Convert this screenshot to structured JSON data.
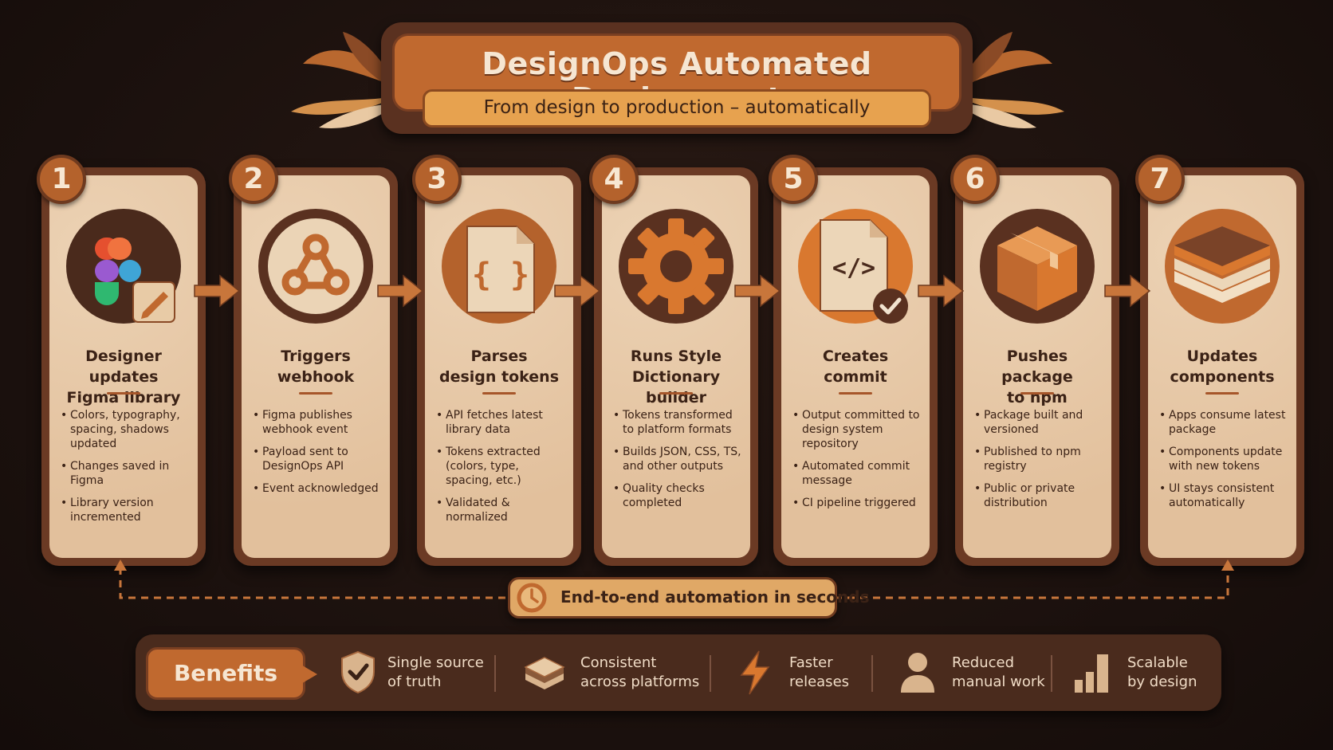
{
  "header": {
    "title": "DesignOps Automated Deployment",
    "subtitle": "From design to production – automatically"
  },
  "steps": [
    {
      "number": "1",
      "title_lines": [
        "Designer updates",
        "Figma library"
      ],
      "icon": "figma-logo-with-pencil",
      "bullets": [
        "Colors, typography, spacing, shadows updated",
        "Changes saved in Figma",
        "Library version incremented"
      ]
    },
    {
      "number": "2",
      "title_lines": [
        "Triggers",
        "webhook"
      ],
      "icon": "webhook-icon",
      "bullets": [
        "Figma publishes webhook event",
        "Payload sent to DesignOps API",
        "Event acknowledged"
      ]
    },
    {
      "number": "3",
      "title_lines": [
        "Parses",
        "design tokens"
      ],
      "icon": "json-file-icon",
      "bullets": [
        "API fetches latest library data",
        "Tokens extracted (colors, type, spacing, etc.)",
        "Validated & normalized"
      ]
    },
    {
      "number": "4",
      "title_lines": [
        "Runs Style",
        "Dictionary builder"
      ],
      "icon": "gear-icon",
      "bullets": [
        "Tokens transformed to platform formats",
        "Builds JSON, CSS, TS, and other outputs",
        "Quality checks completed"
      ]
    },
    {
      "number": "5",
      "title_lines": [
        "Creates",
        "commit"
      ],
      "icon": "code-file-check-icon",
      "bullets": [
        "Output committed to design system repository",
        "Automated commit message",
        "CI pipeline triggered"
      ]
    },
    {
      "number": "6",
      "title_lines": [
        "Pushes package",
        "to npm"
      ],
      "icon": "package-box-icon",
      "bullets": [
        "Package built and versioned",
        "Published to npm registry",
        "Public or private distribution"
      ]
    },
    {
      "number": "7",
      "title_lines": [
        "Updates",
        "components"
      ],
      "icon": "layers-icon",
      "bullets": [
        "Apps consume latest package",
        "Components update with new tokens",
        "UI stays consistent automatically"
      ]
    }
  ],
  "automation": {
    "label": "End-to-end automation in seconds",
    "icon": "clock-icon"
  },
  "benefits": {
    "label": "Benefits",
    "items": [
      {
        "lines": [
          "Single source",
          "of truth"
        ],
        "icon": "shield-check-icon"
      },
      {
        "lines": [
          "Consistent",
          "across platforms"
        ],
        "icon": "layers-icon"
      },
      {
        "lines": [
          "Faster",
          "releases"
        ],
        "icon": "lightning-icon"
      },
      {
        "lines": [
          "Reduced",
          "manual work"
        ],
        "icon": "person-icon"
      },
      {
        "lines": [
          "Scalable",
          "by design"
        ],
        "icon": "bar-chart-icon"
      }
    ]
  },
  "colors": {
    "background": "#1c1210",
    "card": "#e6c7a5",
    "card_frame": "#6b3a24",
    "accent": "#c0692f",
    "text_dark": "#3b2216",
    "text_light": "#f0dcc6"
  }
}
